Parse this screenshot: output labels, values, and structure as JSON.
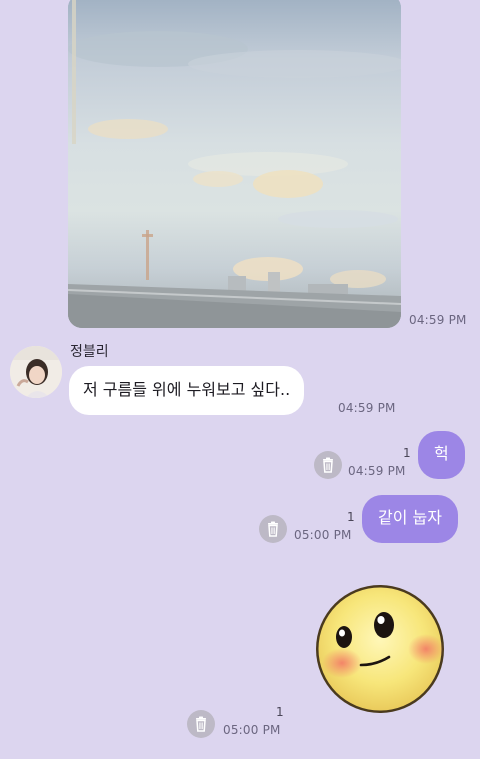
{
  "messages": {
    "photo": {
      "time": "04:59 PM"
    },
    "incoming": {
      "sender": "정블리",
      "text": "저 구름들 위에 누워보고 싶다..",
      "time": "04:59 PM"
    },
    "outgoing": [
      {
        "text": "헉",
        "unread": "1",
        "time": "04:59 PM"
      },
      {
        "text": "같이 눕자",
        "unread": "1",
        "time": "05:00 PM"
      }
    ],
    "emoticon": {
      "unread": "1",
      "time": "05:00 PM"
    }
  },
  "icons": {
    "delete": "trash-icon",
    "emoticon": "blushing-smile-emoticon",
    "avatar": "profile-photo"
  },
  "colors": {
    "background": "#dcd5ef",
    "outgoing_bubble": "#9c86e6",
    "incoming_bubble": "#ffffff",
    "trash_button": "#bdb9c6"
  }
}
